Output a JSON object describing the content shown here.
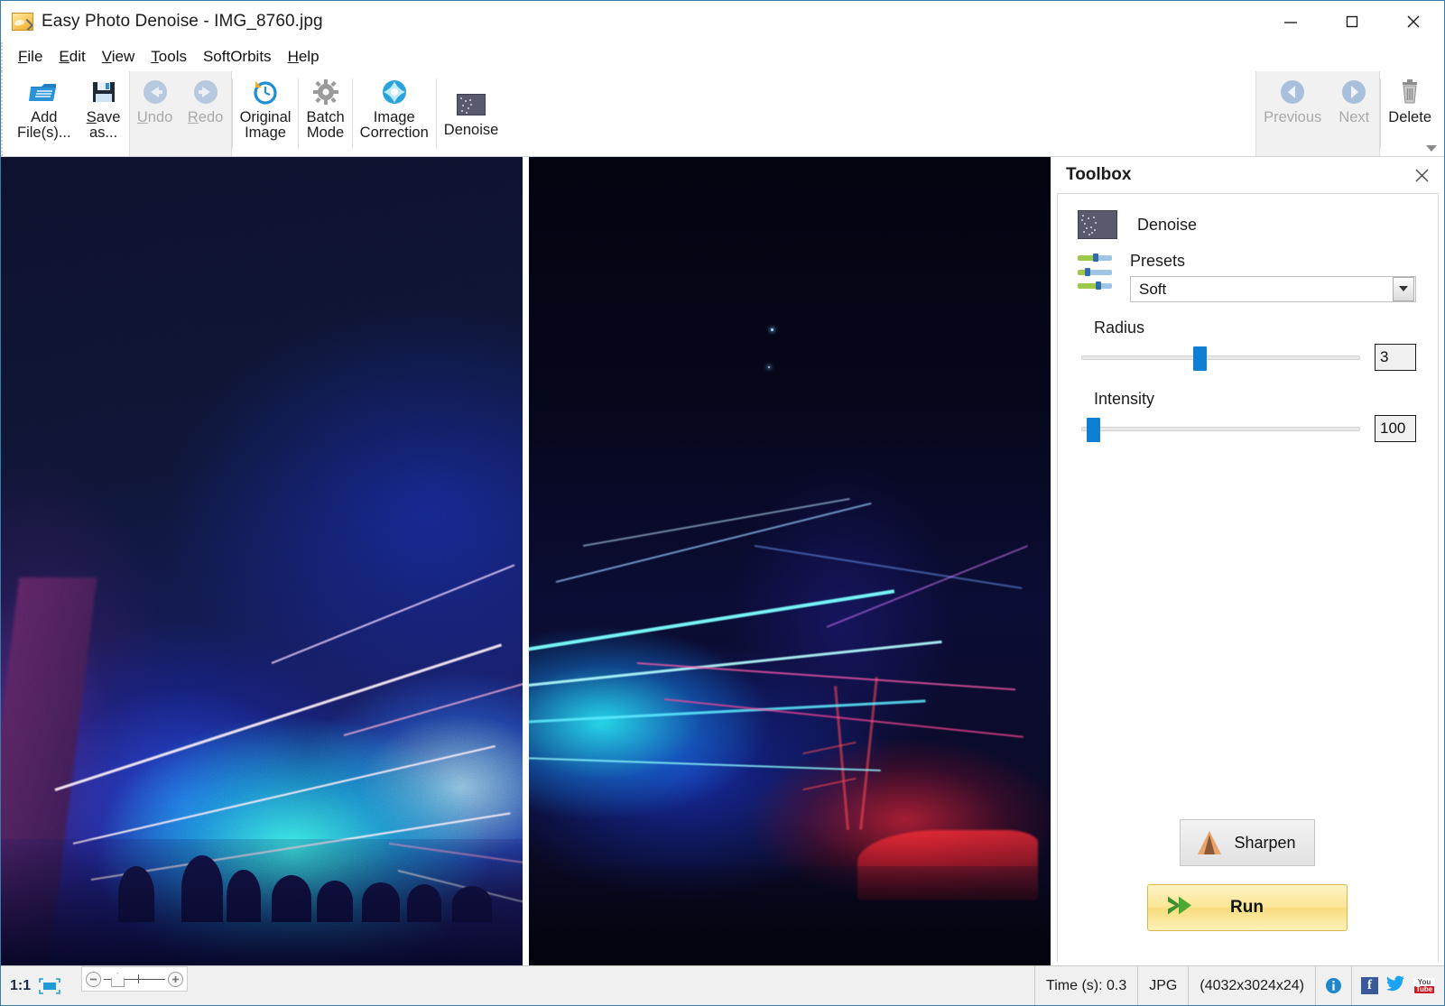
{
  "window": {
    "title": "Easy Photo Denoise - IMG_8760.jpg",
    "app_icon": "photo-image-icon",
    "minimize_label": "Minimize",
    "maximize_label": "Maximize",
    "close_label": "Close"
  },
  "menubar": {
    "items": [
      {
        "label": "File",
        "accel": "F"
      },
      {
        "label": "Edit",
        "accel": "E"
      },
      {
        "label": "View",
        "accel": "V"
      },
      {
        "label": "Tools",
        "accel": "T"
      },
      {
        "label": "SoftOrbits",
        "accel": ""
      },
      {
        "label": "Help",
        "accel": "H"
      }
    ]
  },
  "toolbar": {
    "add_files": {
      "label": "Add\nFile(s)...",
      "icon": "open-folder-icon",
      "enabled": true
    },
    "save_as": {
      "label": "Save\nas...",
      "icon": "floppy-save-icon",
      "enabled": true
    },
    "undo": {
      "label": "Undo",
      "icon": "undo-arrow-icon",
      "enabled": false
    },
    "redo": {
      "label": "Redo",
      "icon": "redo-arrow-icon",
      "enabled": false
    },
    "original_image": {
      "label": "Original\nImage",
      "icon": "clock-revert-icon",
      "enabled": true
    },
    "batch_mode": {
      "label": "Batch\nMode",
      "icon": "gear-icon",
      "enabled": true
    },
    "image_correction": {
      "label": "Image\nCorrection",
      "icon": "brightness-star-icon",
      "enabled": true
    },
    "denoise": {
      "label": "Denoise",
      "icon": "denoise-icon",
      "enabled": true
    },
    "previous": {
      "label": "Previous",
      "icon": "left-circle-arrow-icon",
      "enabled": false
    },
    "next": {
      "label": "Next",
      "icon": "right-circle-arrow-icon",
      "enabled": false
    },
    "delete": {
      "label": "Delete",
      "icon": "trash-can-icon",
      "enabled": true
    },
    "overflow_icon": "chevron-down-icon"
  },
  "toolbox": {
    "title": "Toolbox",
    "close_icon": "close-icon",
    "tool": {
      "name": "Denoise",
      "icon": "denoise-icon"
    },
    "presets": {
      "label": "Presets",
      "icon": "sliders-icon",
      "selected": "Soft",
      "dropdown_icon": "chevron-down-icon"
    },
    "radius": {
      "label": "Radius",
      "value": "3",
      "slider_percent": 40
    },
    "intensity": {
      "label": "Intensity",
      "value": "100",
      "slider_percent": 2
    },
    "sharpen_button": {
      "label": "Sharpen",
      "icon": "cone-sharpen-icon"
    },
    "run_button": {
      "label": "Run",
      "icon": "green-double-arrow-icon"
    }
  },
  "statusbar": {
    "zoom_ratio": "1:1",
    "fit_icon": "fit-to-screen-icon",
    "zoom_out_icon": "minus-icon",
    "zoom_in_icon": "plus-icon",
    "zoom_handle_icon": "home-handle-icon",
    "time": "Time (s): 0.3",
    "format": "JPG",
    "dimensions": "(4032x3024x24)",
    "info_icon": "info-icon",
    "facebook_icon": "facebook-icon",
    "twitter_icon": "twitter-icon",
    "youtube_icon": "youtube-icon",
    "youtube_line1": "You",
    "youtube_line2": "Tube"
  },
  "viewer": {
    "left_pane_name": "original-noisy-preview",
    "right_pane_name": "denoised-result-preview"
  },
  "colors": {
    "accent_blue": "#0f7fd4",
    "run_yellow": "#fbe697",
    "title_border": "#3a7ca8",
    "disabled_text": "#a9a9a9"
  }
}
